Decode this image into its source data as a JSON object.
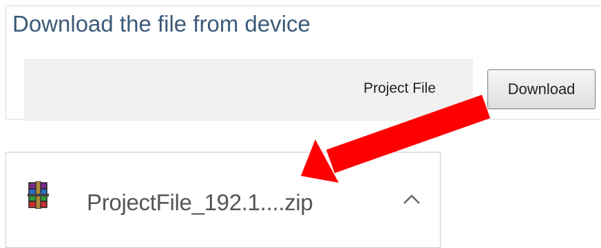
{
  "panel": {
    "title": "Download the file from device",
    "file_label": "Project File",
    "download_label": "Download"
  },
  "download_item": {
    "file_name": "ProjectFile_192.1....zip",
    "icon": "winrar-archive-icon",
    "menu_icon": "chevron-up-icon"
  },
  "annotation": {
    "icon": "red-arrow",
    "color": "#ff0000"
  }
}
